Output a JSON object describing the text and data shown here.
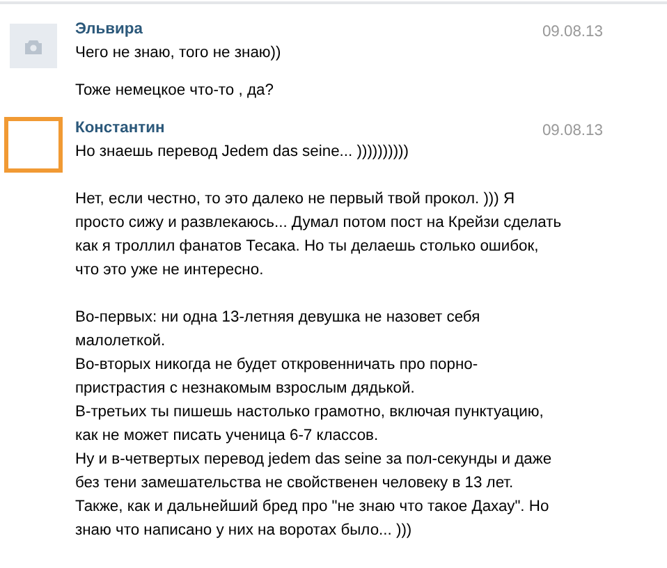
{
  "posts": [
    {
      "author": "Эльвира",
      "date": "09.08.13",
      "avatar": {
        "kind": "camera"
      },
      "messages": [
        [
          [
            "Чего не знаю, того не знаю))"
          ]
        ],
        [
          [
            "Тоже немецкое что-то , да?"
          ]
        ]
      ]
    },
    {
      "author": "Константин",
      "date": "09.08.13",
      "avatar": {
        "kind": "framed"
      },
      "messages": [
        [
          [
            "Но знаешь перевод Jedem das seine... ))))))))))"
          ],
          [
            "Нет, если честно, то это далеко не первый твой прокол. ))) Я просто сижу и развлекаюсь... Думал потом пост на Крейзи сделать как я троллил фанатов Тесака. Но ты делаешь столько ошибок, что это уже не интересно."
          ],
          [
            "Во-первых: ни одна 13-летняя девушка не назовет себя малолеткой.",
            "Во-вторых никогда не будет откровенничать про порно-пристрастия с незнакомым взрослым дядькой.",
            "В-третьих ты пишешь настолько грамотно, включая пунктуацию, как не может писать ученица 6-7 классов.",
            "Ну и в-четвертых перевод jedem das seine за пол-секунды и даже без тени замешательства не свойственен человеку в 13 лет.",
            "Также, как и дальнейший бред про \"не знаю что такое Дахау\". Но знаю что написано у них на воротах было... )))"
          ]
        ]
      ]
    }
  ]
}
